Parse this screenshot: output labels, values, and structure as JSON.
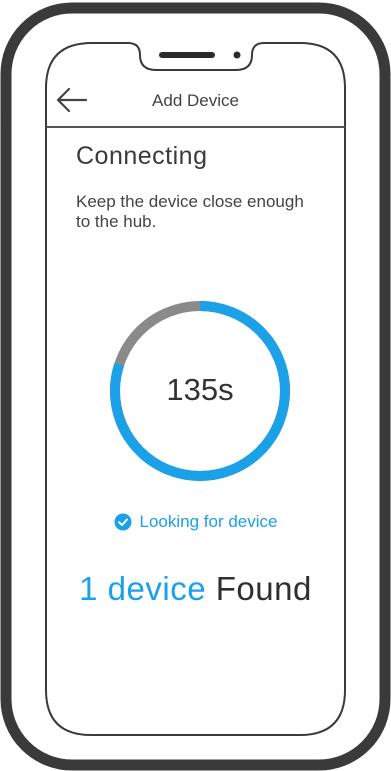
{
  "colors": {
    "accent": "#1AA1E8",
    "ring_track": "#8A8A8A",
    "frame": "#3A3A3A"
  },
  "header": {
    "back_icon": "arrow-left-icon",
    "title": "Add Device"
  },
  "main": {
    "title": "Connecting",
    "instruction": "Keep the device close enough to the hub."
  },
  "timer": {
    "value": "135s",
    "remaining_fraction": 0.8
  },
  "status": {
    "icon": "check-circle-icon",
    "text": "Looking for device"
  },
  "found": {
    "count_text": "1 device",
    "suffix_text": "Found"
  }
}
